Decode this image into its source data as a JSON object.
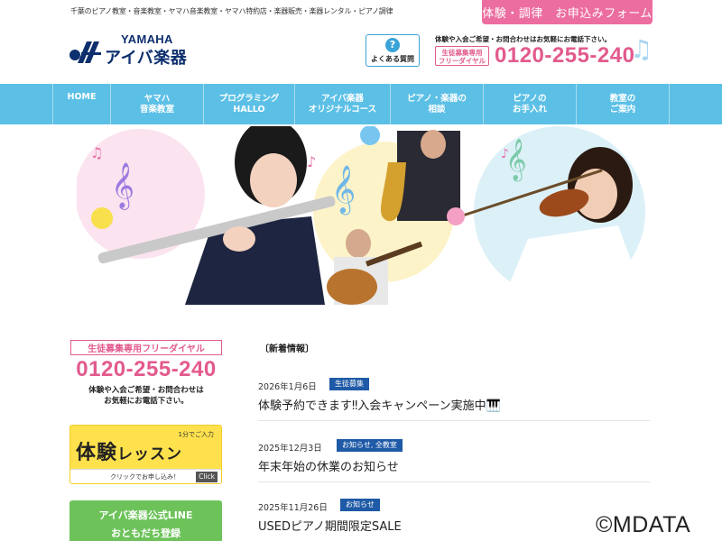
{
  "header": {
    "tagline": "千葉のピアノ教室・音楽教室・ヤマハ音楽教室・ヤマハ特約店・楽器販売・楽器レンタル・ピアノ調律",
    "apply_button": "体験・調律　お申込みフォーム",
    "logo": {
      "brand": "YAMAHA",
      "name": "アイバ楽器"
    },
    "faq_label": "よくある質問",
    "tel_note": "体験や入会ご希望・お問合わせはお気軽にお電話下さい。",
    "tel_badge": "生徒募集専用\nフリーダイヤル",
    "tel_number": "0120-255-240"
  },
  "nav": {
    "items": [
      {
        "label": "HOME"
      },
      {
        "label": "ヤマハ\n音楽教室"
      },
      {
        "label": "プログラミング\nHALLO"
      },
      {
        "label": "アイバ楽器\nオリジナルコース"
      },
      {
        "label": "ピアノ・楽器の\n相談"
      },
      {
        "label": "ピアノの\nお手入れ"
      },
      {
        "label": "教室の\nご案内"
      }
    ]
  },
  "sidebar": {
    "tel_badge": "生徒募集専用フリーダイヤル",
    "tel_number": "0120-255-240",
    "tel_note": "体験や入会ご希望・お問合わせは\nお気軽にお電話下さい。",
    "trial": {
      "small": "1分でご入力",
      "big": "体験",
      "big_sub": "レッスン",
      "footer": "クリックでお申し込み！",
      "click": "Click"
    },
    "line": {
      "line1": "アイバ楽器公式LINE",
      "line2": "おともだち登録"
    }
  },
  "news": {
    "title": "〔新着情報〕",
    "items": [
      {
        "date": "2026年1月6日",
        "tag": "生徒募集",
        "headline": "体験予約できます‼入会キャンペーン実施中🎹"
      },
      {
        "date": "2025年12月3日",
        "tag": "お知らせ, 全教室",
        "headline": "年末年始の休業のお知らせ"
      },
      {
        "date": "2025年11月26日",
        "tag": "お知らせ",
        "headline": "USEDピアノ期間限定SALE"
      }
    ]
  },
  "watermark": "©MDATA",
  "colors": {
    "nav": "#5cc0e6",
    "accent_pink": "#e25a8e",
    "tag_blue": "#1f5aa6",
    "line_green": "#6dc35a",
    "trial_yellow": "#ffe14d"
  },
  "icons": {
    "faq": "question-circle-icon",
    "tel_deco": "music-note-icon"
  }
}
